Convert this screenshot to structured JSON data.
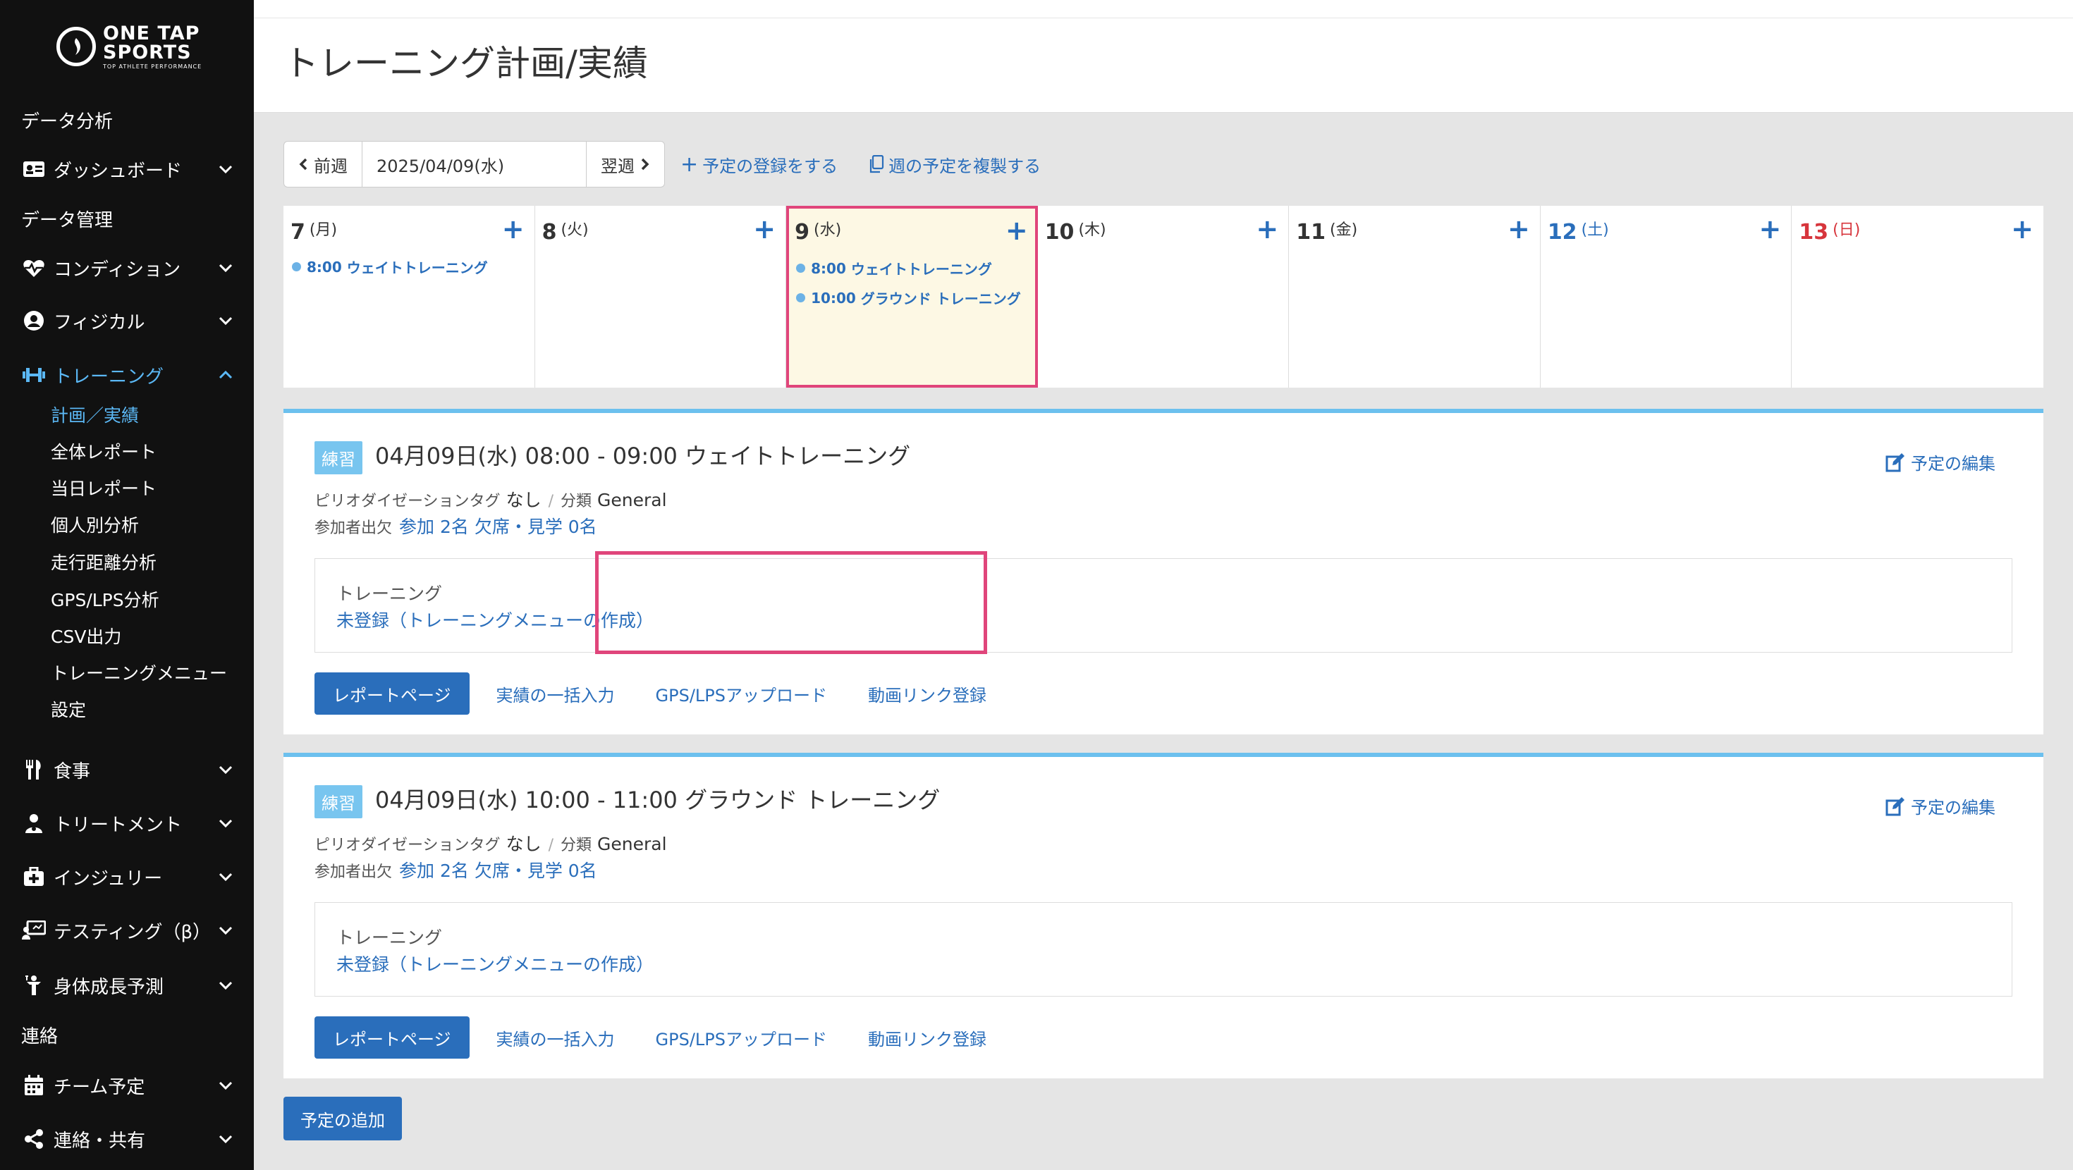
{
  "logo": {
    "line1": "ONE TAP",
    "line2": "SPORTS",
    "tagline": "TOP ATHLETE PERFORMANCE"
  },
  "sidebar": {
    "items": [
      {
        "label": "データ分析"
      },
      {
        "label": "ダッシュボード"
      },
      {
        "label": "データ管理"
      },
      {
        "label": "コンディション"
      },
      {
        "label": "フィジカル"
      },
      {
        "label": "トレーニング"
      },
      {
        "label": "食事"
      },
      {
        "label": "トリートメント"
      },
      {
        "label": "インジュリー"
      },
      {
        "label": "テスティング（β）"
      },
      {
        "label": "身体成長予測"
      },
      {
        "label": "連絡"
      },
      {
        "label": "チーム予定"
      },
      {
        "label": "連絡・共有"
      }
    ],
    "training_sub": [
      {
        "label": "計画／実績"
      },
      {
        "label": "全体レポート"
      },
      {
        "label": "当日レポート"
      },
      {
        "label": "個人別分析"
      },
      {
        "label": "走行距離分析"
      },
      {
        "label": "GPS/LPS分析"
      },
      {
        "label": "CSV出力"
      },
      {
        "label": "トレーニングメニュー"
      },
      {
        "label": "設定"
      }
    ]
  },
  "header": {
    "title": "トレーニング計画/実績"
  },
  "toolbar": {
    "prev": "前週",
    "date": "2025/04/09(水)",
    "next": "翌週",
    "register": "予定の登録をする",
    "copy_week": "週の予定を複製する"
  },
  "calendar": {
    "days": [
      {
        "num": "7",
        "dow": "(月)",
        "events": [
          {
            "time": "8:00",
            "name": "ウェイトトレーニング"
          }
        ]
      },
      {
        "num": "8",
        "dow": "(火)",
        "events": []
      },
      {
        "num": "9",
        "dow": "(水)",
        "events": [
          {
            "time": "8:00",
            "name": "ウェイトトレーニング"
          },
          {
            "time": "10:00",
            "name": "グラウンド トレーニング"
          }
        ]
      },
      {
        "num": "10",
        "dow": "(木)",
        "events": []
      },
      {
        "num": "11",
        "dow": "(金)",
        "events": []
      },
      {
        "num": "12",
        "dow": "(土)",
        "events": []
      },
      {
        "num": "13",
        "dow": "(日)",
        "events": []
      }
    ],
    "plus": "+"
  },
  "events": [
    {
      "badge": "練習",
      "title": "04月09日(水) 08:00 - 09:00 ウェイトトレーニング",
      "edit": "予定の編集",
      "tag_label": "ピリオダイゼーションタグ",
      "tag_value": "なし",
      "category_label": "分類",
      "category_value": "General",
      "attendance_label": "参加者出欠",
      "attendance_value": "参加 2名 欠席・見学 0名",
      "training_label": "トレーニング",
      "training_link": "未登録（トレーニングメニューの作成）",
      "report_btn": "レポートページ",
      "bulk_input": "実績の一括入力",
      "gps_upload": "GPS/LPSアップロード",
      "video_link": "動画リンク登録"
    },
    {
      "badge": "練習",
      "title": "04月09日(水) 10:00 - 11:00 グラウンド トレーニング",
      "edit": "予定の編集",
      "tag_label": "ピリオダイゼーションタグ",
      "tag_value": "なし",
      "category_label": "分類",
      "category_value": "General",
      "attendance_label": "参加者出欠",
      "attendance_value": "参加 2名 欠席・見学 0名",
      "training_label": "トレーニング",
      "training_link": "未登録（トレーニングメニューの作成）",
      "report_btn": "レポートページ",
      "bulk_input": "実績の一括入力",
      "gps_upload": "GPS/LPSアップロード",
      "video_link": "動画リンク登録"
    }
  ],
  "add_schedule": "予定の追加",
  "colors": {
    "accent": "#2a6ebb",
    "highlight": "#e0457b",
    "sidebar_active": "#5bb8f5",
    "today_bg": "#fdf8e4"
  }
}
